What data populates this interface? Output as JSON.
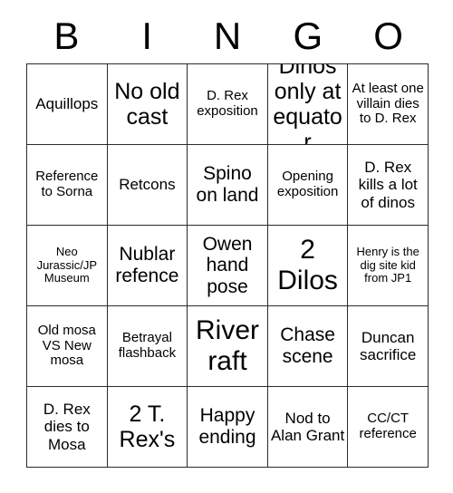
{
  "card": {
    "title_letters": [
      "B",
      "I",
      "N",
      "G",
      "O"
    ],
    "columns": 5,
    "rows": 5,
    "border_color": "#2b2b2b",
    "text_color": "#000000",
    "background_color": "#ffffff",
    "cells": [
      {
        "text": "Aquillops",
        "size": "m"
      },
      {
        "text": "No old cast",
        "size": "xl"
      },
      {
        "text": "D. Rex exposition",
        "size": "s"
      },
      {
        "text": "Dinos only at equator",
        "size": "xl"
      },
      {
        "text": "At least one villain dies to D. Rex",
        "size": "s"
      },
      {
        "text": "Reference to Sorna",
        "size": "s"
      },
      {
        "text": "Retcons",
        "size": "m"
      },
      {
        "text": "Spino on land",
        "size": "l"
      },
      {
        "text": "Opening exposition",
        "size": "s"
      },
      {
        "text": "D. Rex kills a lot of dinos",
        "size": "m"
      },
      {
        "text": "Neo Jurassic/JP Museum",
        "size": "xs"
      },
      {
        "text": "Nublar refence",
        "size": "l"
      },
      {
        "text": "Owen hand pose",
        "size": "l"
      },
      {
        "text": "2 Dilos",
        "size": "xxl"
      },
      {
        "text": "Henry is the dig site kid from JP1",
        "size": "xs"
      },
      {
        "text": "Old mosa VS New mosa",
        "size": "s"
      },
      {
        "text": "Betrayal flashback",
        "size": "s"
      },
      {
        "text": "River raft",
        "size": "xxl"
      },
      {
        "text": "Chase scene",
        "size": "l"
      },
      {
        "text": "Duncan sacrifice",
        "size": "m"
      },
      {
        "text": "D. Rex dies to Mosa",
        "size": "m"
      },
      {
        "text": "2 T. Rex's",
        "size": "xl"
      },
      {
        "text": "Happy ending",
        "size": "l"
      },
      {
        "text": "Nod to Alan Grant",
        "size": "m"
      },
      {
        "text": "CC/CT reference",
        "size": "s"
      }
    ]
  }
}
